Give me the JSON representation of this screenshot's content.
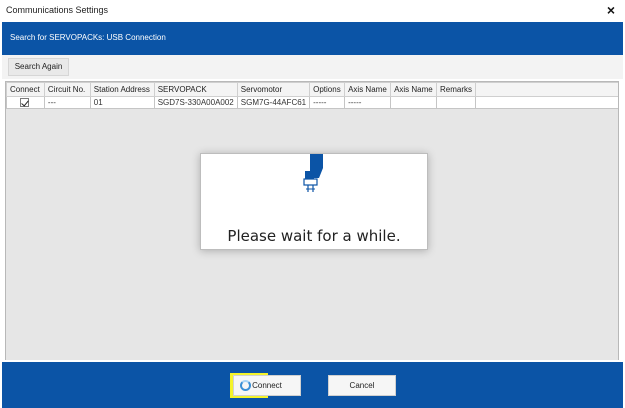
{
  "window": {
    "title": "Communications Settings",
    "close_symbol": "×"
  },
  "header": {
    "text": "Search for SERVOPACKs: USB Connection"
  },
  "toolbar": {
    "search_again_label": "Search Again"
  },
  "table": {
    "columns": [
      "Connect",
      "Circuit No.",
      "Station Address",
      "SERVOPACK",
      "Servomotor",
      "Options",
      "Axis Name",
      "Axis Name",
      "Remarks"
    ],
    "rows": [
      {
        "connect_checked": true,
        "circuit_no": "---",
        "station_address": "01",
        "servopack": "SGD7S-330A00A002",
        "servomotor": "SGM7G-44AFC61",
        "options": "-----",
        "axis_name_1": "-----",
        "axis_name_2": "",
        "remarks": ""
      }
    ]
  },
  "wait_dialog": {
    "message": "Please wait for a while.",
    "icon": "usb-plug-icon"
  },
  "footer": {
    "connect_label": "Connect",
    "cancel_label": "Cancel"
  },
  "colors": {
    "accent_blue": "#0b54a6",
    "highlight_yellow": "#f4f32a"
  }
}
